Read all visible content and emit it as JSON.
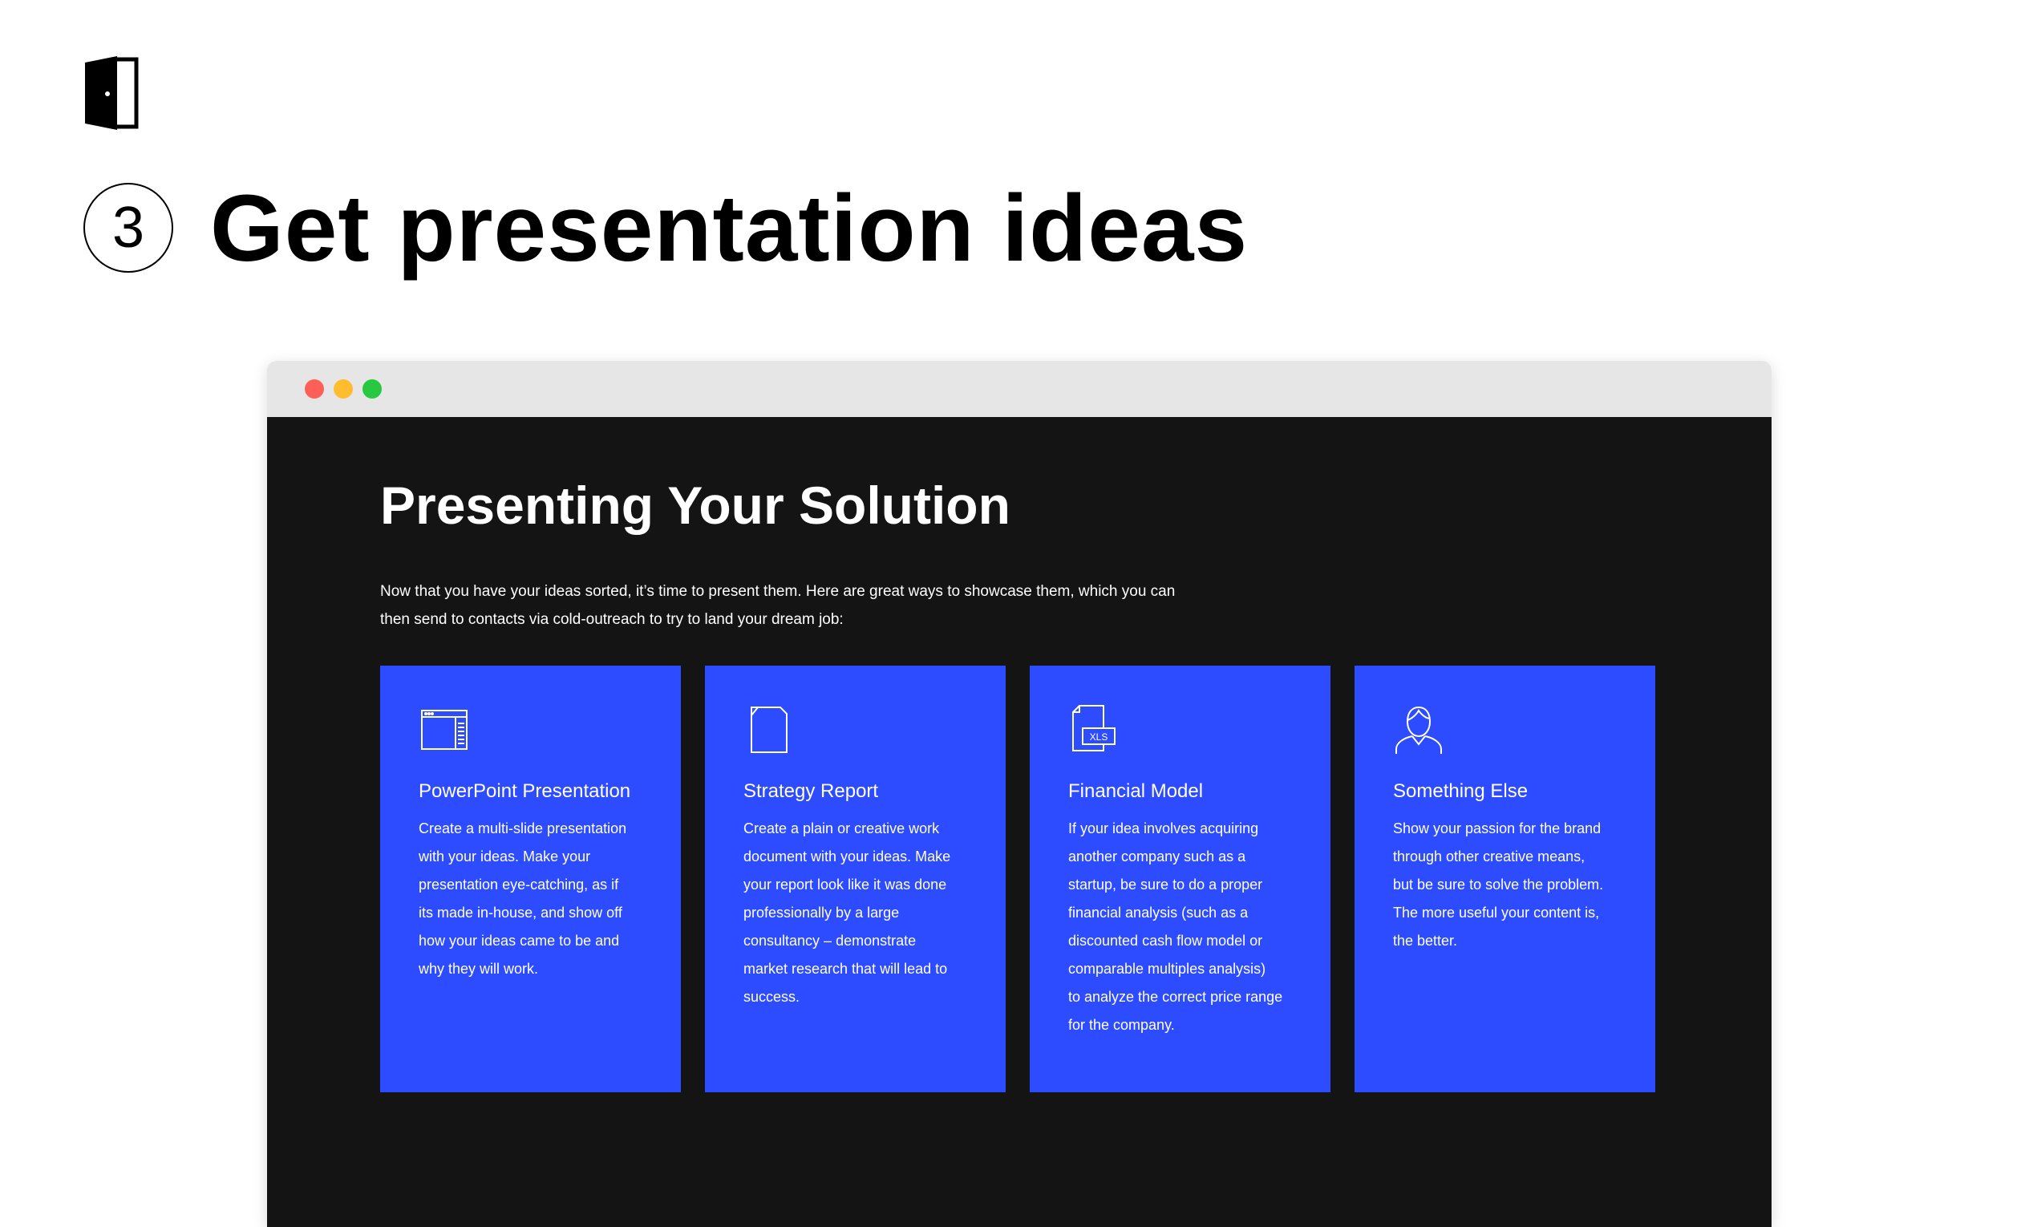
{
  "header": {
    "step_number": "3",
    "title": "Get presentation ideas",
    "logo_icon": "door-icon"
  },
  "window": {
    "controls": [
      "close",
      "minimize",
      "maximize"
    ],
    "colors": {
      "close": "#fe5f57",
      "minimize": "#febc2e",
      "maximize": "#28c840"
    }
  },
  "content": {
    "title": "Presenting Your Solution",
    "intro_line1": "Now that you have your ideas sorted, it’s time to present them. Here are great ways to showcase them, which you can",
    "intro_line2": "then send to contacts via cold-outreach to try to land your dream job:",
    "background": "#141414",
    "card_color": "#2d4bff",
    "cards": [
      {
        "icon": "slides-window-icon",
        "title": "PowerPoint Presentation",
        "lines": [
          "Create a multi-slide presentation",
          "with your ideas. Make your",
          "presentation eye-catching, as if",
          "its made in-house, and show off",
          "how your ideas came to be and",
          "why they will work."
        ]
      },
      {
        "icon": "document-icon",
        "title": "Strategy Report",
        "lines": [
          "Create a plain or creative work",
          "document with your ideas. Make",
          "your report look like it was done",
          "professionally by a large",
          "consultancy – demonstrate",
          "market research that will lead to",
          "success."
        ]
      },
      {
        "icon": "xls-file-icon",
        "icon_text": "XLS",
        "title": "Financial Model",
        "lines": [
          "If your idea involves acquiring",
          "another company such as a",
          "startup, be sure to do a proper",
          "financial analysis (such as a",
          "discounted cash flow model or",
          "comparable multiples analysis)",
          "to analyze the correct price range",
          "for the company."
        ]
      },
      {
        "icon": "person-icon",
        "title": "Something Else",
        "lines": [
          "Show your passion for the brand",
          "through other creative means,",
          "but be sure to solve the problem.",
          "The more useful your content is,",
          "the better."
        ]
      }
    ]
  }
}
